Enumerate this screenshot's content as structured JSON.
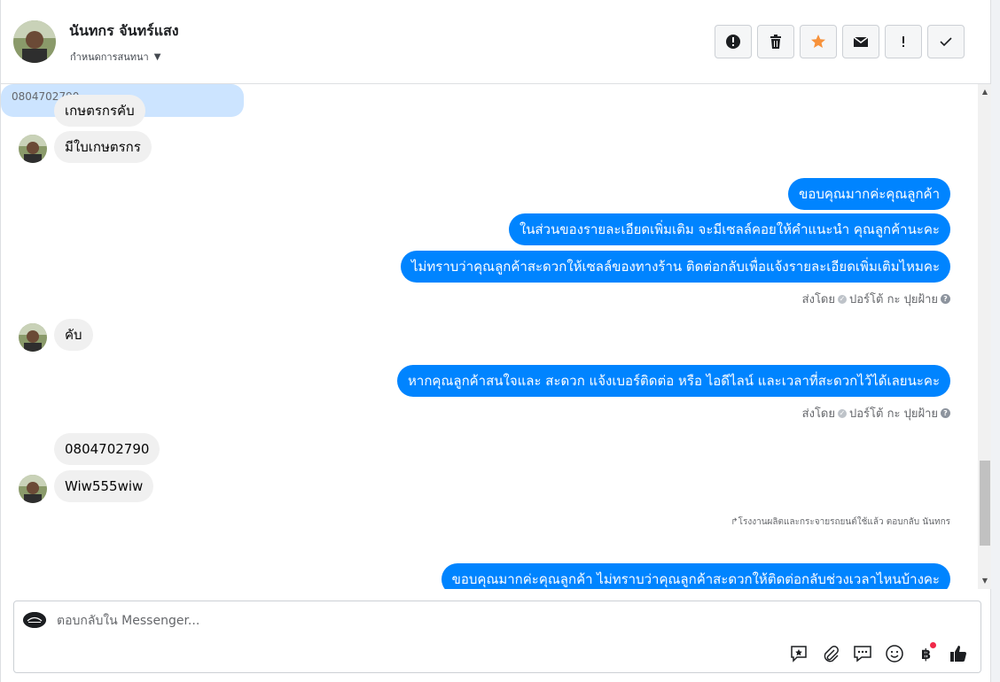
{
  "header": {
    "contact_name": "นันทกร จันทร์แสง",
    "assign_label": "กำหนดการสนทนา",
    "actions": [
      {
        "name": "spam-icon",
        "color": "#1c1e21"
      },
      {
        "name": "trash-icon",
        "color": "#1c1e21"
      },
      {
        "name": "star-icon",
        "color": "#f7923b"
      },
      {
        "name": "envelope-icon",
        "color": "#1c1e21"
      },
      {
        "name": "follow-up-icon",
        "color": "#1c1e21"
      },
      {
        "name": "check-icon",
        "color": "#1c1e21"
      }
    ]
  },
  "messages": {
    "in1": "เกษตรกรคับ",
    "in2": "มีใบเกษตรกร",
    "out1": "ขอบคุณมากค่ะคุณลูกค้า",
    "out2": "ในส่วนของรายละเอียดเพิ่มเติม จะมีเซลล์คอยให้คำแนะนำ คุณลูกค้านะคะ",
    "out3": "ไม่ทราบว่าคุณลูกค้าสะดวกให้เซลล์ของทางร้าน ติดต่อกลับเพื่อแจ้งรายละเอียดเพิ่มเติมไหมคะ",
    "sent_by_1_prefix": "ส่งโดย",
    "sent_by_1_name": "ปอร์โต้ กะ ปุยฝ้าย",
    "in3": "คับ",
    "out4": "หากคุณลูกค้าสนใจและ สะดวก แจ้งเบอร์ติดต่อ หรือ ไอดีไลน์ และเวลาที่สะดวกไว้ได้เลยนะคะ",
    "sent_by_2_prefix": "ส่งโดย",
    "sent_by_2_name": "ปอร์โต้ กะ ปุยฝ้าย",
    "in4": "0804702790",
    "in5": "Wiw555wiw",
    "reply_note": "โรงงานผลิตและกระจายรถยนต์ใช้แล้ว ตอบกลับ นันทกร",
    "quoted": "0804702790",
    "out5": "ขอบคุณมากค่ะคุณลูกค้า ไม่ทราบว่าคุณลูกค้าสะดวกให้ติดต่อกลับช่วงเวลาไหนบ้างคะ"
  },
  "composer": {
    "placeholder": "ตอบกลับใน Messenger...",
    "tools": [
      "saved-reply-icon",
      "attachment-icon",
      "chat-icon",
      "emoji-icon",
      "baht-icon",
      "like-icon"
    ],
    "accent": "#1c1e21"
  },
  "colors": {
    "outgoing": "#0084ff",
    "incoming": "#f0f0f0",
    "quoted": "#cce4ff"
  }
}
